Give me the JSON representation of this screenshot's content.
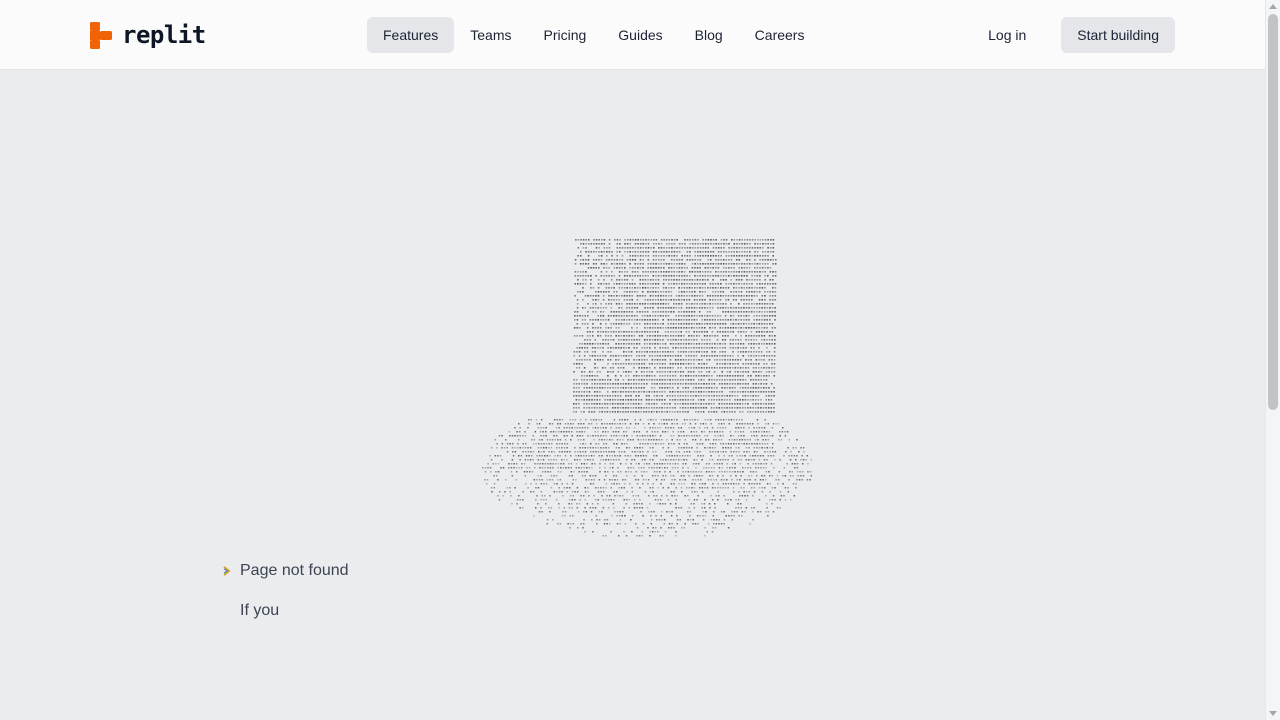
{
  "brand": {
    "name": "replit",
    "accent": "#f26207"
  },
  "nav": {
    "links": [
      {
        "label": "Features",
        "active": true
      },
      {
        "label": "Teams",
        "active": false
      },
      {
        "label": "Pricing",
        "active": false
      },
      {
        "label": "Guides",
        "active": false
      },
      {
        "label": "Blog",
        "active": false
      },
      {
        "label": "Careers",
        "active": false
      }
    ],
    "login_label": "Log in",
    "cta_label": "Start building"
  },
  "hero": {
    "art_icon": "ascii-top-hat-illustration",
    "status_icon": "caret-right-icon",
    "status_text": "Page not found",
    "lead_text": "If you"
  },
  "colors": {
    "page_bg": "#ebecee",
    "nav_bg": "#fbfbfc",
    "button_bg": "#e4e6ea",
    "caret_color": "#c9a227"
  }
}
